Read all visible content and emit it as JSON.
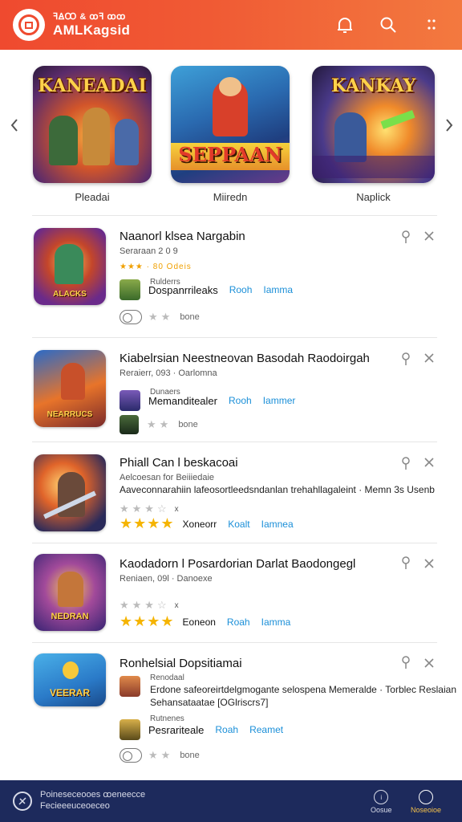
{
  "header": {
    "brand_sub": "ꟻꙘꚘ & ꝏꟻ ꝏꝏ",
    "brand_main": "AMLKagsid"
  },
  "carousel": {
    "items": [
      {
        "title": "KANEADAI",
        "label": "Pleadai"
      },
      {
        "title": "SEPPAAN",
        "label": "Miiredn"
      },
      {
        "title": "KANKAY",
        "label": "Naplick"
      }
    ]
  },
  "list": [
    {
      "title": "Naanorl klsea Nargabin",
      "subtitle": "Seraraan 2 0 9",
      "rating_text": "★★★ · 80 Odeis",
      "mini_label": "Rulderrs",
      "name": "Dospanrrileaks",
      "link1": "Rooh",
      "link2": "Iamma",
      "footer_text": "bone",
      "thumb_text": "ALACKS"
    },
    {
      "title": "Kiabelrsian Neestneovan Basodah Raodoirgah",
      "subtitle": "Reraierr, 093 · Oarlomna",
      "mini_label": "Dunaers",
      "name": "Memanditealer",
      "link1": "Rooh",
      "link2": "Iammer",
      "footer_text": "bone",
      "thumb_text": "NEARRUCS"
    },
    {
      "title": "Phiall Can l beskacoai",
      "subtitle": "Aelcoesan for Beiiiedaie",
      "description": "Aaveconnarahiin lafeosortleedsndanlan trehahllagaleint · Memn 3s Usenb",
      "rating_label": "x",
      "name": "Xoneorr",
      "link1": "Koalt",
      "link2": "Iamnea"
    },
    {
      "title": "Kaodadorn l Posardorian Darlat Baodongegl",
      "subtitle": "Reniaen, 09l · Danoexe",
      "rating_label": "x",
      "name": "Eoneon",
      "link1": "Roah",
      "link2": "Iamma",
      "thumb_text": "NEDRAN"
    },
    {
      "title": "Ronhelsial Dopsitiamai",
      "mini_label_a": "Renodaal",
      "description": "Erdone safeoreirtdelgmogante selospena Memeralde · Torblec Reslaian",
      "description2": "Sehansataatae                                    [OGlriscrs7]",
      "mini_label_b": "Rutnenes",
      "name": "Pesrariteale",
      "link1": "Roah",
      "link2": "Reamet",
      "footer_text": "bone",
      "thumb_text": "VEERAR"
    }
  ],
  "footer": {
    "line1": "Poineseceooes ꝏeneecce",
    "line2": "Fecieeeuceoeceo",
    "nav1": "Oosue",
    "nav2": "Noseoioe"
  },
  "colors": {
    "header_start": "#ef4a2f",
    "header_end": "#f3793f",
    "link": "#1b8fd8",
    "footer_bg": "#1d2a5c",
    "star_gold": "#f5b400"
  }
}
